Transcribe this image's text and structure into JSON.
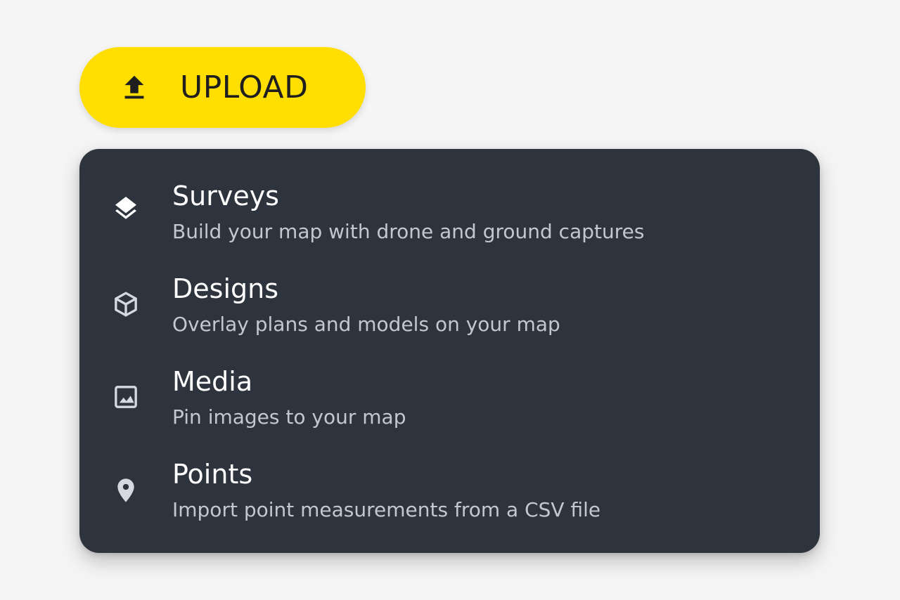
{
  "upload_button": {
    "label": "UPLOAD",
    "icon": "upload-icon",
    "color": "#ffde00"
  },
  "menu": {
    "background": "#2e343d",
    "items": [
      {
        "title": "Surveys",
        "description": "Build your map with drone and ground captures",
        "icon": "layers-icon"
      },
      {
        "title": "Designs",
        "description": "Overlay plans and models on your map",
        "icon": "cube-icon"
      },
      {
        "title": "Media",
        "description": "Pin images to your map",
        "icon": "image-icon"
      },
      {
        "title": "Points",
        "description": "Import point measurements from a CSV file",
        "icon": "location-pin-icon"
      }
    ]
  }
}
